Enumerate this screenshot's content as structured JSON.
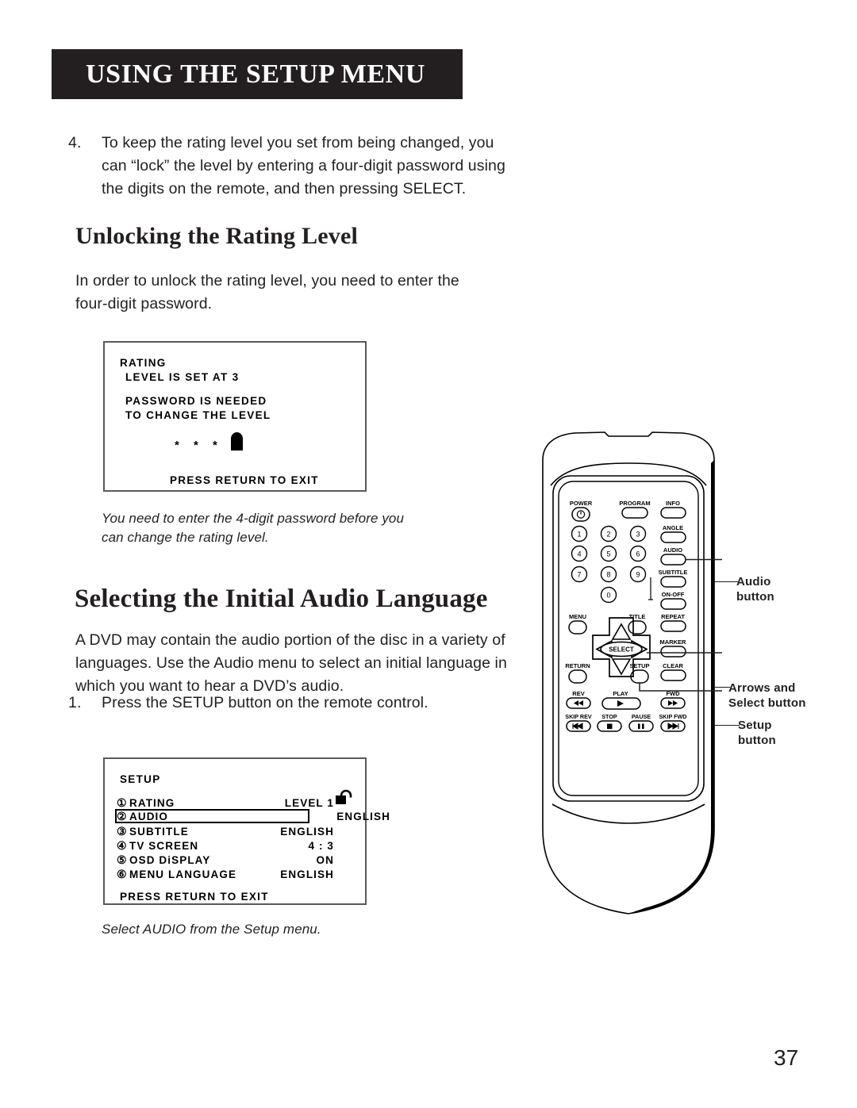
{
  "header": {
    "title": "USING THE SETUP MENU"
  },
  "steps": {
    "step4": {
      "number": "4.",
      "text": "To keep the rating level you set from being changed, you can “lock” the level by entering a four-digit password using the digits on the remote, and then pressing SELECT."
    },
    "step1": {
      "number": "1.",
      "text": "Press the SETUP button on the remote control."
    }
  },
  "sections": {
    "unlocking_heading": "Unlocking the Rating Level",
    "unlocking_paragraph": "In order to unlock the rating level, you need to enter the four-digit password.",
    "audio_heading": "Selecting the Initial Audio Language",
    "audio_paragraph": "A DVD may contain the audio portion of the disc in a variety of languages. Use the Audio menu to select an initial language in which you want to hear a DVD’s audio."
  },
  "osd_rating": {
    "title": "RATING",
    "level_line": "LEVEL IS SET AT 3",
    "password_line1": "PASSWORD IS NEEDED",
    "password_line2": "TO CHANGE THE LEVEL",
    "password_mask": "* * * *",
    "lock_icon": "lock-closed-icon",
    "exit_line": "PRESS RETURN TO EXIT"
  },
  "caption_rating": "You need to enter the  4-digit password before you can change the rating level.",
  "osd_setup": {
    "title": "SETUP",
    "lock_icon": "lock-open-icon",
    "rows": [
      {
        "num": "①",
        "label": "RATING",
        "value": "LEVEL 1"
      },
      {
        "num": "②",
        "label": "AUDIO",
        "value": "ENGLISH"
      },
      {
        "num": "③",
        "label": "SUBTITLE",
        "value": "ENGLISH"
      },
      {
        "num": "④",
        "label": "TV SCREEN",
        "value": "4 : 3"
      },
      {
        "num": "⑤",
        "label": "OSD DiSPLAY",
        "value": "ON"
      },
      {
        "num": "⑥",
        "label": "MENU LANGUAGE",
        "value": "ENGLISH"
      }
    ],
    "exit_line": "PRESS RETURN TO EXIT"
  },
  "caption_setup": "Select AUDIO from the Setup menu.",
  "remote": {
    "buttons": {
      "power": "POWER",
      "program": "PROGRAM",
      "info": "INFO",
      "angle": "ANGLE",
      "audio": "AUDIO",
      "subtitle": "SUBTITLE",
      "on_off": "ON-OFF",
      "menu": "MENU",
      "title": "TITLE",
      "repeat": "REPEAT",
      "select": "SELECT",
      "marker": "MARKER",
      "return": "RETURN",
      "setup": "SETUP",
      "clear": "CLEAR",
      "rev": "REV",
      "play": "PLAY",
      "fwd": "FWD",
      "skip_rev": "SKIP REV",
      "stop": "STOP",
      "pause": "PAUSE",
      "skip_fwd": "SKIP FWD"
    },
    "keypad": [
      "1",
      "2",
      "3",
      "4",
      "5",
      "6",
      "7",
      "8",
      "9",
      "0"
    ]
  },
  "callouts": {
    "audio": "Audio\nbutton",
    "audio_line1": "Audio",
    "audio_line2": "button",
    "arrows_line1": "Arrows and",
    "arrows_line2": "Select button",
    "setup_line1": "Setup",
    "setup_line2": "button"
  },
  "page_number": "37"
}
